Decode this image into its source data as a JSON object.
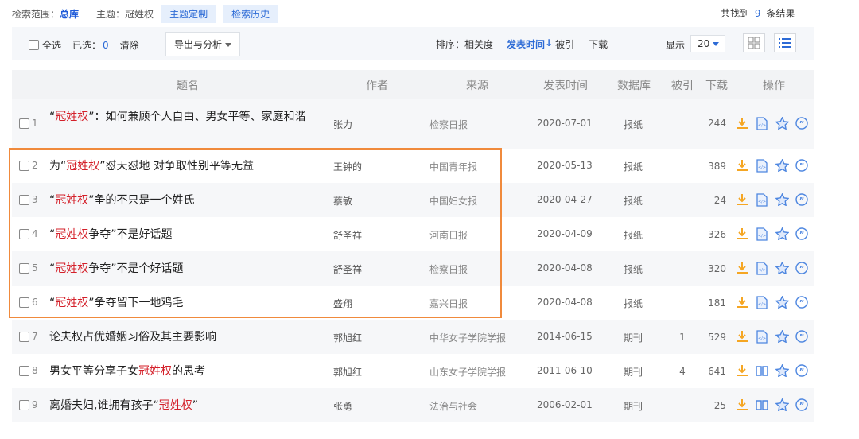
{
  "search": {
    "scope_label": "检索范围：",
    "scope_value": "总库",
    "topic_label": "主题：",
    "topic_value": "冠姓权",
    "custom_btn": "主题定制",
    "history_btn": "检索历史",
    "found_prefix": "共找到",
    "found_count": "9",
    "found_suffix": "条结果"
  },
  "toolbar": {
    "select_all": "全选",
    "selected_label": "已选：",
    "selected_count": "0",
    "clear": "清除",
    "export": "导出与分析",
    "sort_label": "排序：",
    "sort_relevance": "相关度",
    "sort_date": "发表时间",
    "sort_cited": "被引",
    "sort_download": "下载",
    "display_label": "显示",
    "page_size": "20"
  },
  "columns": {
    "title": "题名",
    "author": "作者",
    "source": "来源",
    "date": "发表时间",
    "db": "数据库",
    "cited": "被引",
    "downloads": "下载",
    "ops": "操作"
  },
  "rows": [
    {
      "n": "1",
      "pre": "“",
      "hl": "冠姓权",
      "post": "”：如何兼顾个人自由、男女平等、家庭和谐",
      "author": "张力",
      "source": "检察日报",
      "date": "2020-07-01",
      "db": "报纸",
      "cited": "",
      "downloads": "244",
      "read_icon": "html-icon"
    },
    {
      "n": "2",
      "pre": "为“",
      "hl": "冠姓权",
      "post": "”怼天怼地 对争取性别平等无益",
      "author": "王钟的",
      "source": "中国青年报",
      "date": "2020-05-13",
      "db": "报纸",
      "cited": "",
      "downloads": "389",
      "read_icon": "html-icon"
    },
    {
      "n": "3",
      "pre": "“",
      "hl": "冠姓权",
      "post": "”争的不只是一个姓氏",
      "author": "蔡敏",
      "source": "中国妇女报",
      "date": "2020-04-27",
      "db": "报纸",
      "cited": "",
      "downloads": "24",
      "read_icon": "html-icon"
    },
    {
      "n": "4",
      "pre": "“",
      "hl": "冠姓权",
      "post": "争夺”不是好话题",
      "author": "舒圣祥",
      "source": "河南日报",
      "date": "2020-04-09",
      "db": "报纸",
      "cited": "",
      "downloads": "326",
      "read_icon": "html-icon"
    },
    {
      "n": "5",
      "pre": "“",
      "hl": "冠姓权",
      "post": "争夺”不是个好话题",
      "author": "舒圣祥",
      "source": "检察日报",
      "date": "2020-04-08",
      "db": "报纸",
      "cited": "",
      "downloads": "320",
      "read_icon": "html-icon"
    },
    {
      "n": "6",
      "pre": "“",
      "hl": "冠姓权",
      "post": "”争夺留下一地鸡毛",
      "author": "盛翔",
      "source": "嘉兴日报",
      "date": "2020-04-08",
      "db": "报纸",
      "cited": "",
      "downloads": "181",
      "read_icon": "html-icon"
    },
    {
      "n": "7",
      "pre": "论夫权占优婚姻习俗及其主要影响",
      "hl": "",
      "post": "",
      "author": "郭旭红",
      "source": "中华女子学院学报",
      "date": "2014-06-15",
      "db": "期刊",
      "cited": "1",
      "downloads": "529",
      "read_icon": "html-icon"
    },
    {
      "n": "8",
      "pre": "男女平等分享子女",
      "hl": "冠姓权",
      "post": "的思考",
      "author": "郭旭红",
      "source": "山东女子学院学报",
      "date": "2011-06-10",
      "db": "期刊",
      "cited": "4",
      "downloads": "641",
      "read_icon": "book-icon"
    },
    {
      "n": "9",
      "pre": "离婚夫妇,谁拥有孩子“",
      "hl": "冠姓权",
      "post": "”",
      "author": "张勇",
      "source": "法治与社会",
      "date": "2006-02-01",
      "db": "期刊",
      "cited": "",
      "downloads": "25",
      "read_icon": "book-icon"
    }
  ],
  "colors": {
    "accent": "#2d6bd6",
    "highlight": "#d4202a",
    "download": "#f5a623",
    "box": "#f08a3c"
  }
}
